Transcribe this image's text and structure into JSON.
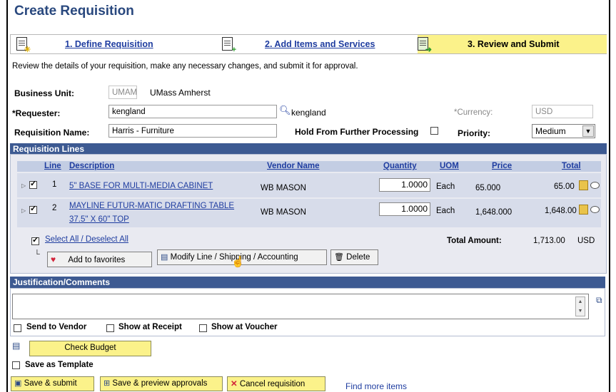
{
  "page": {
    "title": "Create Requisition"
  },
  "steps": [
    {
      "label": "1. Define Requisition"
    },
    {
      "label": "2. Add Items and Services"
    },
    {
      "label": "3. Review and Submit"
    }
  ],
  "instructions": "Review the details of your requisition, make any necessary changes, and submit it for approval.",
  "header": {
    "business_unit_label": "Business Unit:",
    "business_unit_value": "UMAMH",
    "business_unit_desc": "UMass Amherst",
    "requester_label": "*Requester:",
    "requester_value": "kengland",
    "requester_desc": "kengland",
    "currency_label": "*Currency:",
    "currency_value": "USD",
    "req_name_label": "Requisition Name:",
    "req_name_value": "Harris - Furniture",
    "hold_label": "Hold From Further Processing",
    "priority_label": "Priority:",
    "priority_value": "Medium"
  },
  "lines": {
    "section_title": "Requisition Lines",
    "columns": {
      "line": "Line",
      "description": "Description",
      "vendor": "Vendor Name",
      "quantity": "Quantity",
      "uom": "UOM",
      "price": "Price",
      "total": "Total"
    },
    "rows": [
      {
        "line": "1",
        "description": "5\" BASE FOR MULTI-MEDIA CABINET",
        "vendor": "WB MASON",
        "quantity": "1.0000",
        "uom": "Each",
        "price": "65.000",
        "total": "65.00"
      },
      {
        "line": "2",
        "description_line1": "MAYLINE FUTUR-MATIC DRAFTING TABLE",
        "description_line2": "37.5\" X 60\" TOP",
        "vendor": "WB MASON",
        "quantity": "1.0000",
        "uom": "Each",
        "price": "1,648.000",
        "total": "1,648.00"
      }
    ],
    "select_all": "Select All / Deselect All",
    "total_amount_label": "Total Amount:",
    "total_amount_value": "1,713.00",
    "total_currency": "USD",
    "add_favorites": "Add to favorites",
    "modify_line": "Modify Line / Shipping / Accounting",
    "delete": "Delete"
  },
  "justification": {
    "section_title": "Justification/Comments",
    "send_to_vendor": "Send to Vendor",
    "show_at_receipt": "Show at Receipt",
    "show_at_voucher": "Show at Voucher"
  },
  "footer": {
    "check_budget": "Check Budget",
    "save_template": "Save as Template",
    "save_submit": "Save & submit",
    "save_preview": "Save & preview approvals",
    "cancel": "Cancel requisition",
    "find_more": "Find more items"
  },
  "colors": {
    "title": "#29487e",
    "section_bar": "#3d5a92",
    "highlight": "#fbf28a",
    "link": "#1f3da0"
  }
}
